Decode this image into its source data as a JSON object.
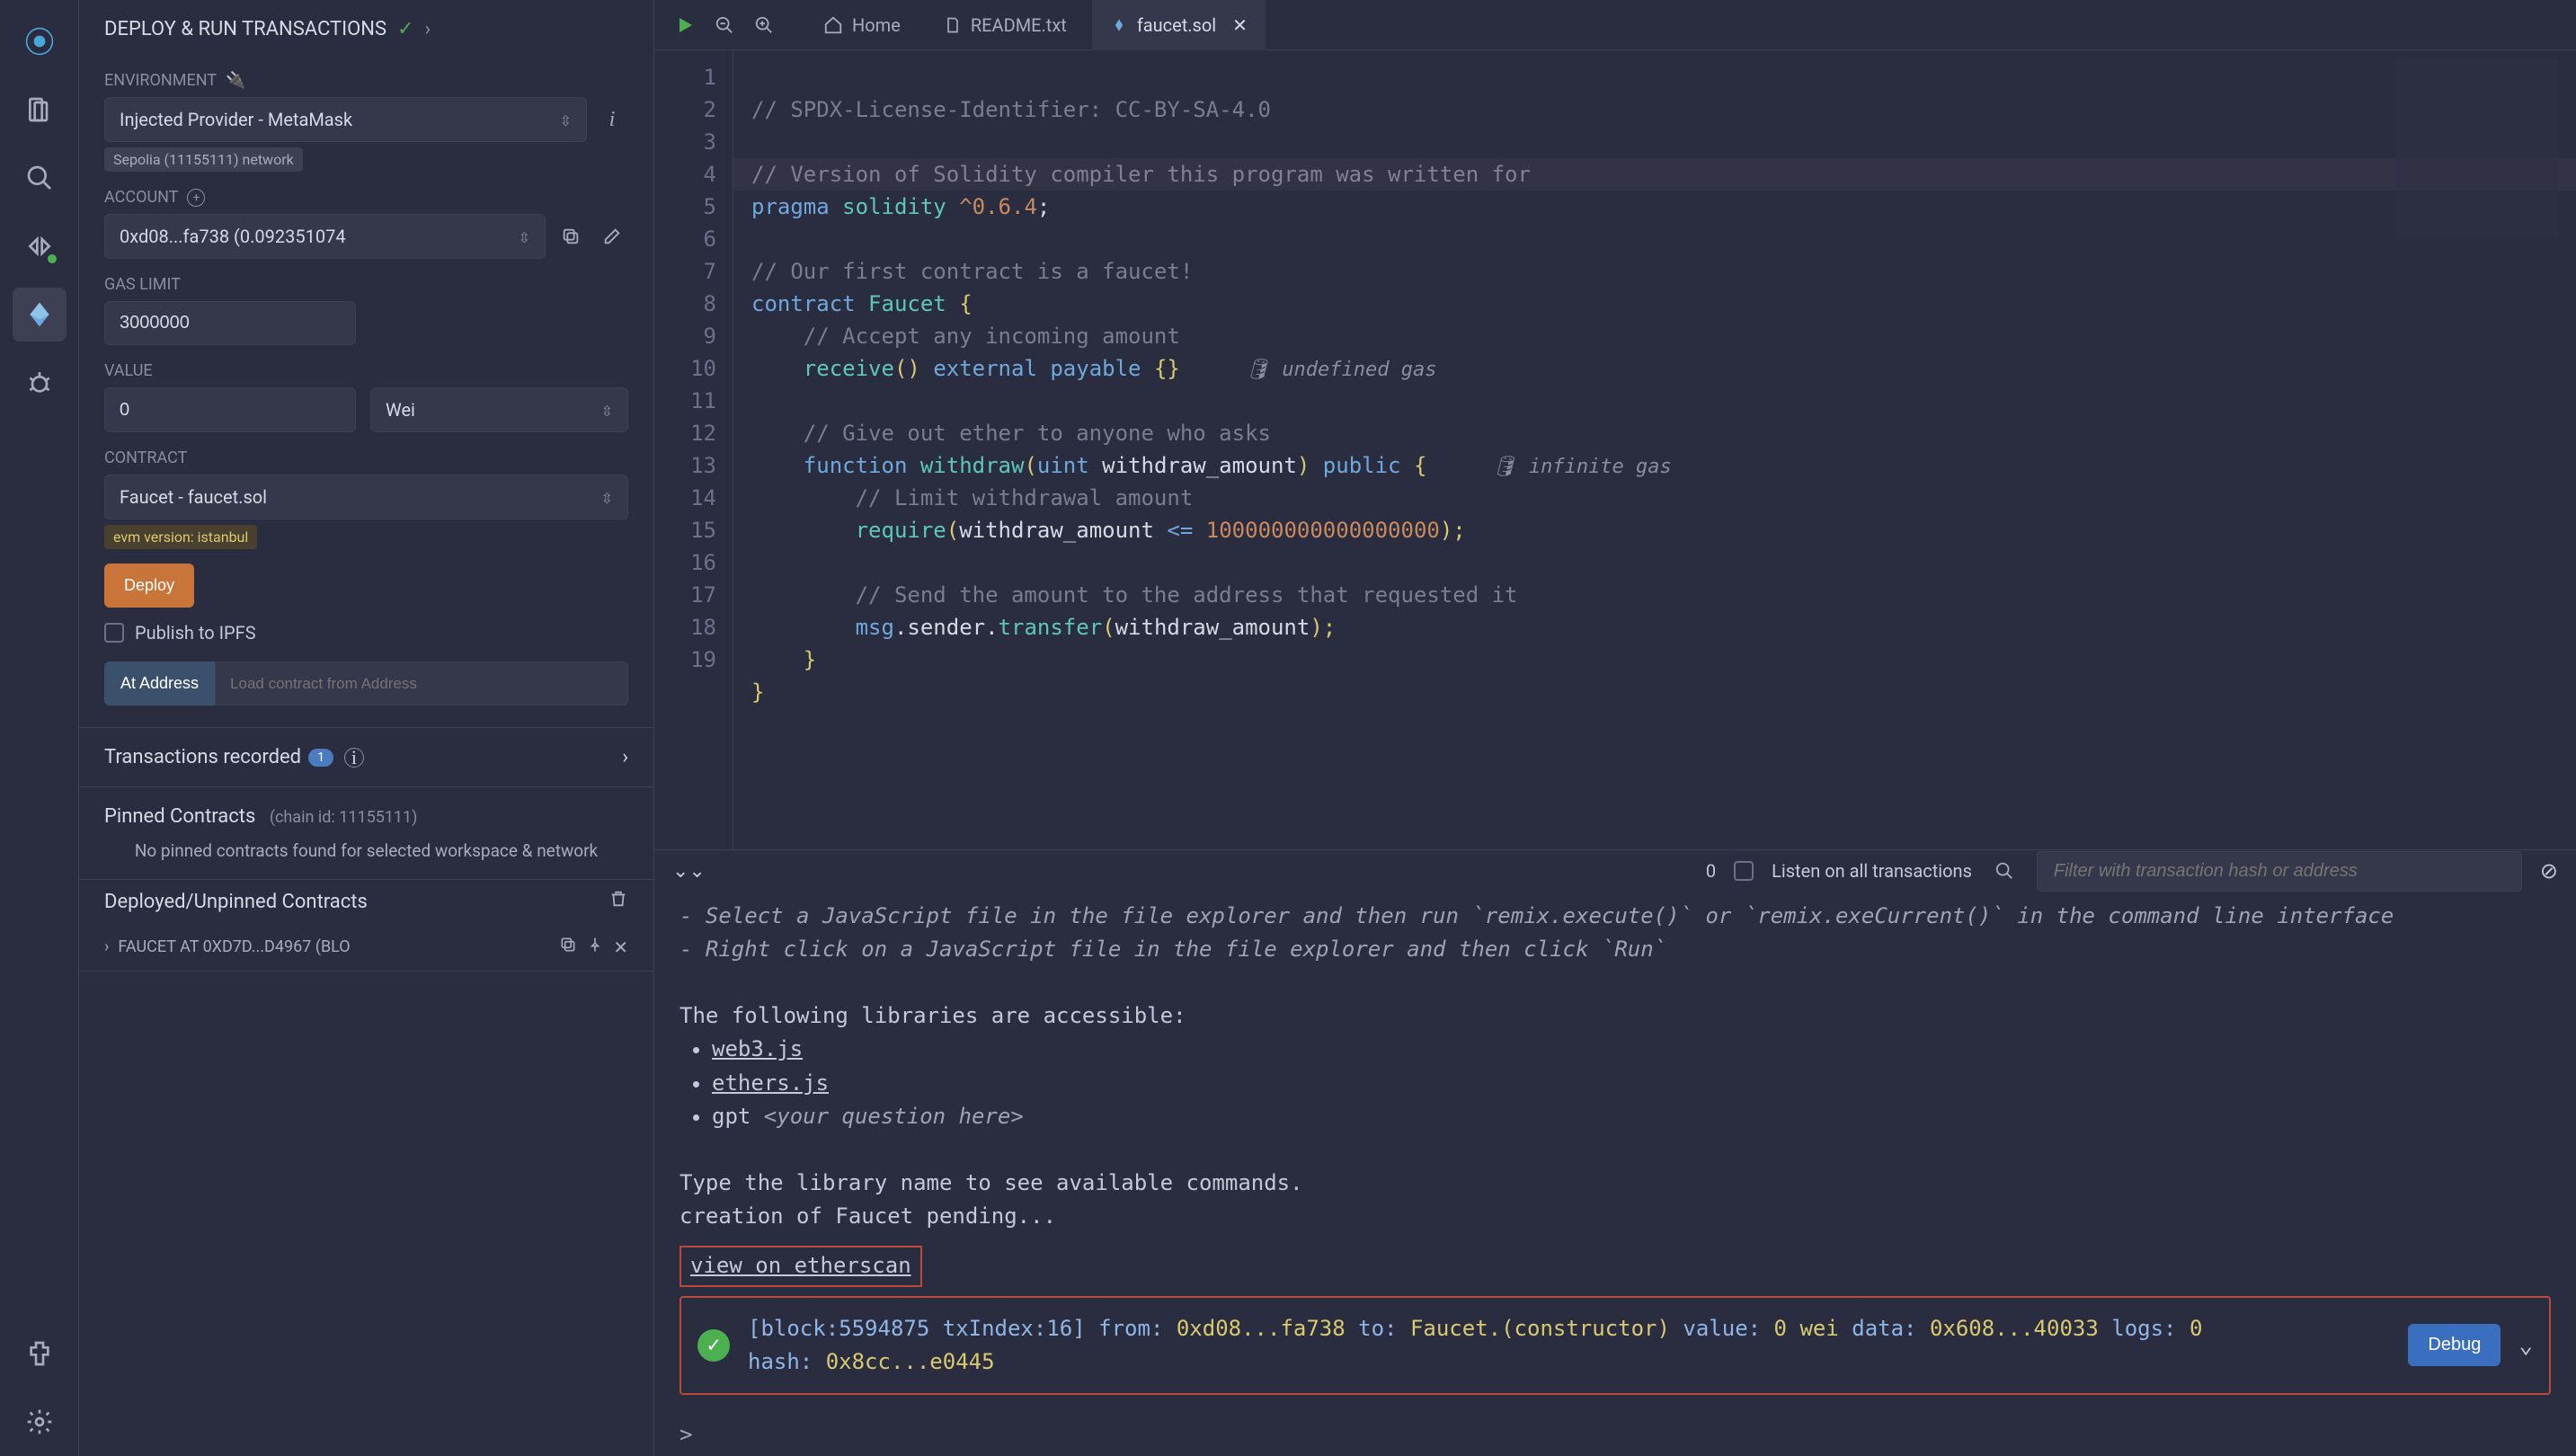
{
  "panel": {
    "title": "DEPLOY & RUN TRANSACTIONS",
    "environment_label": "ENVIRONMENT",
    "environment_value": "Injected Provider - MetaMask",
    "network_chip": "Sepolia (11155111) network",
    "account_label": "ACCOUNT",
    "account_value": "0xd08...fa738 (0.092351074",
    "gas_label": "GAS LIMIT",
    "gas_value": "3000000",
    "value_label": "VALUE",
    "value_amount": "0",
    "value_unit": "Wei",
    "contract_label": "CONTRACT",
    "contract_value": "Faucet - faucet.sol",
    "evm_chip": "evm version: istanbul",
    "deploy_btn": "Deploy",
    "publish_ipfs": "Publish to IPFS",
    "at_address_btn": "At Address",
    "at_address_placeholder": "Load contract from Address",
    "tx_recorded_label": "Transactions recorded",
    "tx_recorded_count": "1",
    "pinned_label": "Pinned Contracts",
    "pinned_sub": "(chain id: 11155111)",
    "pinned_empty": "No pinned contracts found for selected workspace & network",
    "deployed_label": "Deployed/Unpinned Contracts",
    "deployed_item": "FAUCET AT 0XD7D...D4967 (BLO"
  },
  "tabs": {
    "home": "Home",
    "readme": "README.txt",
    "faucet": "faucet.sol"
  },
  "code": {
    "line1": "// SPDX-License-Identifier: CC-BY-SA-4.0",
    "line3a": "// Version of Solidity compiler this program was written for",
    "line4_pragma": "pragma",
    "line4_solidity": "solidity",
    "line4_ver": "^0.6.4",
    "line6": "// Our first contract is a faucet!",
    "line7_contract": "contract",
    "line7_name": "Faucet",
    "line8": "// Accept any incoming amount",
    "line9_receive": "receive",
    "line9_ext": "external",
    "line9_pay": "payable",
    "line9_ann": "undefined gas",
    "line11": "// Give out ether to anyone who asks",
    "line12_fn": "function",
    "line12_name": "withdraw",
    "line12_type": "uint",
    "line12_param": "withdraw_amount",
    "line12_pub": "public",
    "line12_ann": "infinite gas",
    "line13": "// Limit withdrawal amount",
    "line14_req": "require",
    "line14_arg": "withdraw_amount",
    "line14_op": "<=",
    "line14_num": "100000000000000000",
    "line16": "// Send the amount to the address that requested it",
    "line17_msg": "msg",
    "line17_send": ".sender.",
    "line17_transfer": "transfer",
    "line17_arg": "withdraw_amount"
  },
  "terminal": {
    "listen_count": "0",
    "listen_label": "Listen on all transactions",
    "filter_placeholder": "Filter with transaction hash or address",
    "hint1": "- Select a JavaScript file in the file explorer and then run `remix.execute()` or `remix.exeCurrent()` in the command line interface",
    "hint2": "- Right click on a JavaScript file in the file explorer and then click `Run`",
    "libs_intro": "The following libraries are accessible:",
    "lib1": "web3.js",
    "lib2": "ethers.js",
    "lib3_a": "gpt ",
    "lib3_b": "<your question here>",
    "type_intro": "Type the library name to see available commands.",
    "creation": "creation of Faucet pending...",
    "view_etherscan": "view on etherscan",
    "tx_block": "[block:5594875 txIndex:16]",
    "tx_from_lbl": "from:",
    "tx_from": "0xd08...fa738",
    "tx_to_lbl": "to:",
    "tx_to": "Faucet.(constructor)",
    "tx_value_lbl": "value:",
    "tx_value": "0 wei",
    "tx_data_lbl": "data:",
    "tx_data": "0x608...40033",
    "tx_logs_lbl": "logs:",
    "tx_logs": "0",
    "tx_hash_lbl": "hash:",
    "tx_hash": "0x8cc...e0445",
    "debug_btn": "Debug",
    "prompt": ">"
  }
}
